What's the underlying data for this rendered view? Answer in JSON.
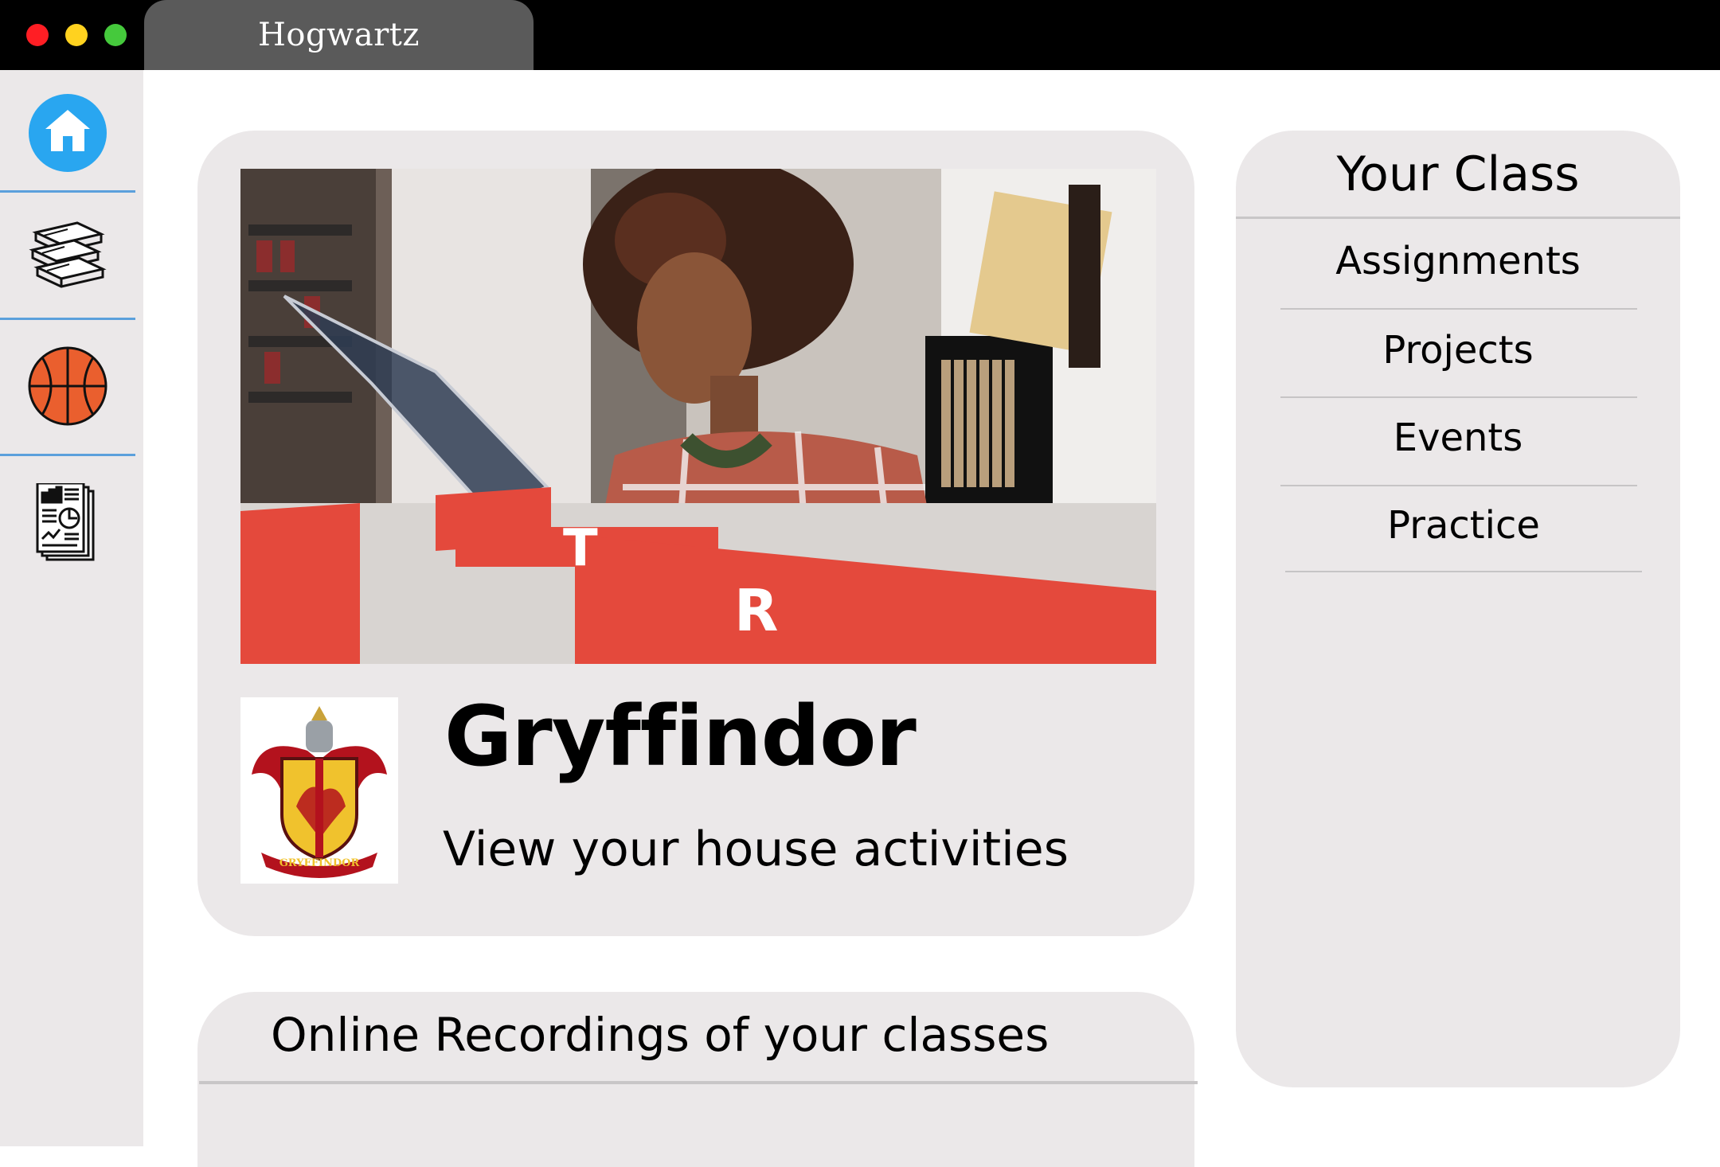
{
  "window": {
    "tab_title": "Hogwartz",
    "controls": [
      "close",
      "minimize",
      "maximize"
    ]
  },
  "sidebar": {
    "items": [
      {
        "name": "home",
        "icon": "home-icon",
        "active": true,
        "accent": "#29a6f0"
      },
      {
        "name": "books",
        "icon": "books-icon"
      },
      {
        "name": "sports",
        "icon": "basketball-icon",
        "accent": "#ea5f2e"
      },
      {
        "name": "reports",
        "icon": "report-icon"
      }
    ]
  },
  "house": {
    "name": "Gryffindor",
    "subtitle": "View your house activities",
    "crest_text": "GRYFFINDOR",
    "crest_icon": "gryffindor-crest-icon",
    "banner_letters": [
      "T",
      "R"
    ],
    "colors": {
      "red": "#b3121d",
      "gold": "#f0c22d"
    }
  },
  "recordings": {
    "title": "Online Recordings of your classes"
  },
  "your_class": {
    "title": "Your Class",
    "items": [
      "Assignments",
      "Projects",
      "Events",
      "Practice"
    ]
  }
}
